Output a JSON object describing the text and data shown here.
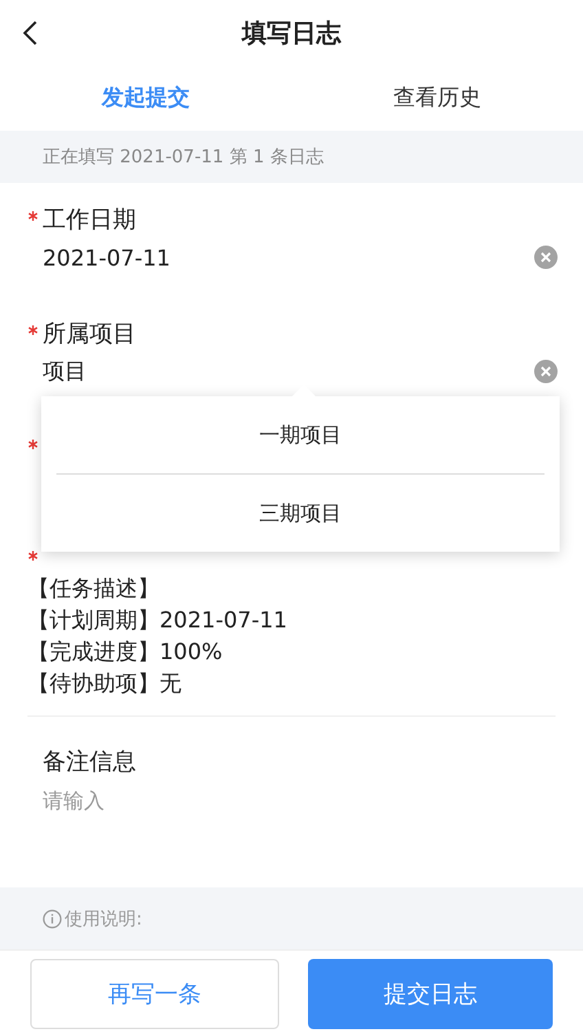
{
  "header": {
    "title": "填写日志"
  },
  "tabs": [
    {
      "label": "发起提交",
      "selected": true
    },
    {
      "label": "查看历史",
      "selected": false
    }
  ],
  "notice": "正在填写 2021-07-11 第 1 条日志",
  "fields": [
    {
      "kind": "input",
      "required": true,
      "label": "工作日期",
      "value": "2021-07-11",
      "clearable": true
    },
    {
      "kind": "input",
      "required": true,
      "label": "所属项目",
      "value": "项目",
      "clearable": true,
      "dropdown": {
        "options": [
          {
            "label": "一期项目"
          },
          {
            "label": "三期项目"
          }
        ]
      }
    },
    {
      "kind": "input",
      "required": true
    },
    {
      "kind": "lines",
      "required": true,
      "lines": [
        "【任务描述】",
        "【计划周期】2021-07-11",
        "【完成进度】100%",
        "【待协助项】无"
      ]
    },
    {
      "kind": "input",
      "required": false,
      "label": "备注信息",
      "placeholder": "请输入"
    }
  ],
  "help": "使用说明:",
  "buttons": [
    {
      "label": "再写一条",
      "kind": "secondary"
    },
    {
      "label": "提交日志",
      "kind": "primary"
    }
  ]
}
